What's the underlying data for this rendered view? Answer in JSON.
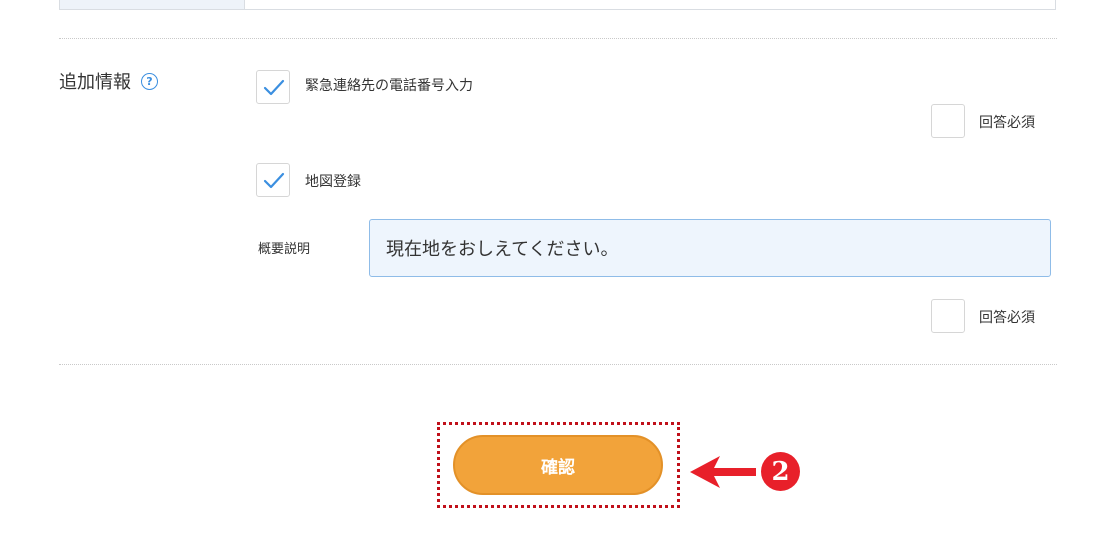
{
  "section": {
    "label": "追加情報",
    "help_icon": "question-circle-icon"
  },
  "emergency_contact": {
    "label": "緊急連絡先の電話番号入力",
    "checked": true,
    "required_label": "回答必須",
    "required_checked": false
  },
  "map_registration": {
    "label": "地図登録",
    "checked": true,
    "description_label": "概要説明",
    "description_value": "現在地をおしえてください。",
    "required_label": "回答必須",
    "required_checked": false
  },
  "confirm_button": {
    "label": "確認"
  },
  "annotation": {
    "step_number": "2",
    "arrow_icon": "arrow-left-icon",
    "color": "#e8202a"
  },
  "colors": {
    "accent_blue": "#3b8fe0",
    "button_orange": "#f2a33a",
    "annotation_red": "#c0101a"
  }
}
